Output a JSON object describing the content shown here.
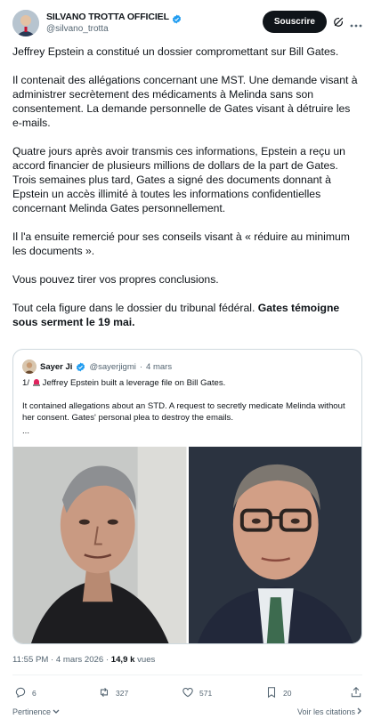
{
  "author": {
    "name": "SILVANO TROTTA OFFICIEL",
    "handle": "@silvano_trotta",
    "verified_color": "#1d9bf0"
  },
  "header": {
    "subscribe_label": "Souscrire"
  },
  "tweet": {
    "paragraphs": [
      "Jeffrey Epstein a constitué un dossier compromettant sur Bill Gates.",
      "Il contenait des allégations concernant une MST. Une demande visant à administrer secrètement des médicaments à Melinda sans son consentement. La demande personnelle de Gates visant à détruire les e-mails.",
      "Quatre jours après avoir transmis ces informations, Epstein a reçu un accord financier de plusieurs millions de dollars de la part de Gates. Trois semaines plus tard, Gates a signé des documents donnant à Epstein un accès illimité à toutes les informations confidentielles concernant Melinda Gates personnellement.",
      "Il l'a ensuite remercié pour ses conseils visant à « réduire au minimum les documents ».",
      "Vous pouvez tirer vos propres conclusions."
    ],
    "last_paragraph_plain": "Tout cela figure dans le dossier du tribunal fédéral. ",
    "last_paragraph_bold": "Gates témoigne sous serment le 19 mai."
  },
  "quote": {
    "name": "Sayer Ji",
    "handle": "@sayerjigmi",
    "separator": "·",
    "date": "4 mars",
    "line1_prefix": "1/ ",
    "line1": "Jeffrey Epstein built a leverage file on Bill Gates.",
    "line2": "It contained allegations about an STD. A request to secretly medicate Melinda without her consent. Gates' personal plea to destroy the emails.",
    "ellipsis": "..."
  },
  "meta": {
    "time": "11:55 PM · 4 mars 2026 · ",
    "views_count": "14,9 k",
    "views_label": " vues"
  },
  "actions": {
    "replies": "6",
    "reposts": "327",
    "likes": "571",
    "bookmarks": "20"
  },
  "footer": {
    "relevance": "Pertinence",
    "quotes_link": "Voir les citations"
  },
  "colors": {
    "text": "#0f1419",
    "secondary": "#536471",
    "border": "#cfd9de",
    "accent": "#1d9bf0"
  }
}
